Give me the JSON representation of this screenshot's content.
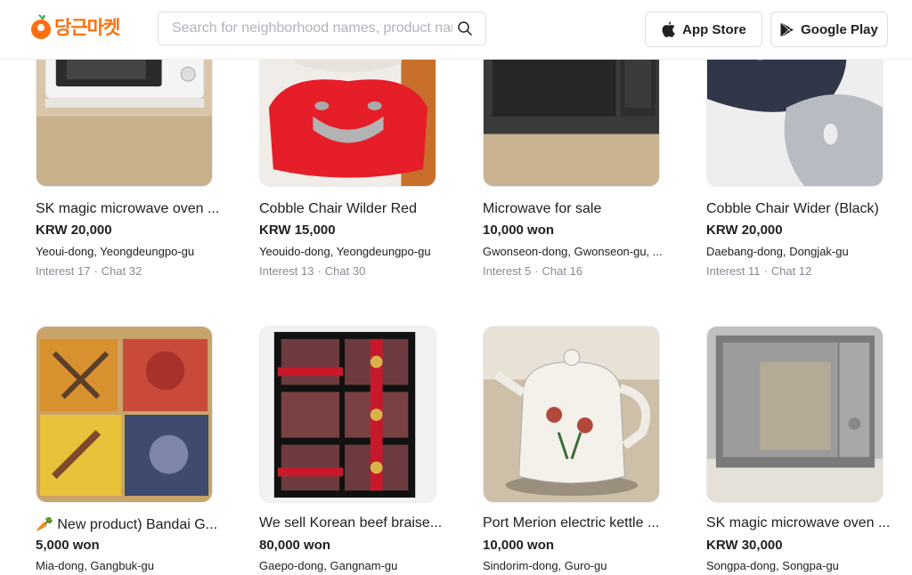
{
  "header": {
    "logo_text": "당근마켓",
    "search_placeholder": "Search for neighborhood names, product names",
    "app_store_label": "App Store",
    "google_play_label": "Google Play"
  },
  "products": [
    {
      "title": "SK magic microwave oven ...",
      "price": "KRW 20,000",
      "region": "Yeoui-dong, Yeongdeungpo-gu",
      "interest": "Interest 17",
      "chat": "Chat 32"
    },
    {
      "title": "Cobble Chair Wilder Red",
      "price": "KRW 15,000",
      "region": "Yeouido-dong, Yeongdeungpo-gu",
      "interest": "Interest 13",
      "chat": "Chat 30"
    },
    {
      "title": "Microwave for sale",
      "price": "10,000 won",
      "region": "Gwonseon-dong, Gwonseon-gu, ...",
      "interest": "Interest 5",
      "chat": "Chat 16"
    },
    {
      "title": "Cobble Chair Wider (Black)",
      "price": "KRW 20,000",
      "region": "Daebang-dong, Dongjak-gu",
      "interest": "Interest 11",
      "chat": "Chat 12"
    },
    {
      "title": "🥕 New product) Bandai G...",
      "price": "5,000 won",
      "region": "Mia-dong, Gangbuk-gu"
    },
    {
      "title": "We sell Korean beef braise...",
      "price": "80,000 won",
      "region": "Gaepo-dong, Gangnam-gu"
    },
    {
      "title": "Port Merion electric kettle ...",
      "price": "10,000 won",
      "region": "Sindorim-dong, Guro-gu"
    },
    {
      "title": "SK magic microwave oven ...",
      "price": "KRW 30,000",
      "region": "Songpa-dong, Songpa-gu"
    }
  ]
}
